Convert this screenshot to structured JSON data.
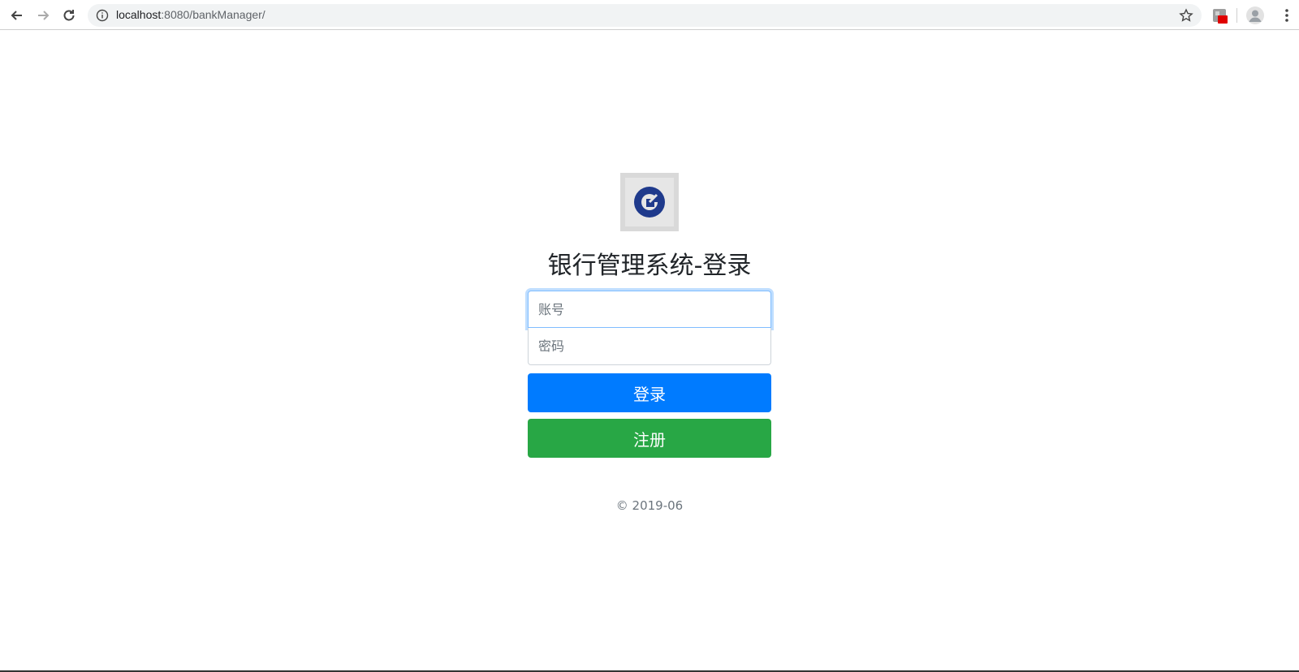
{
  "browser": {
    "url_host": "localhost",
    "url_rest": ":8080/bankManager/"
  },
  "login": {
    "title": "银行管理系统-登录",
    "account_placeholder": "账号",
    "password_placeholder": "密码",
    "login_label": "登录",
    "register_label": "注册",
    "copyright": "© 2019-06"
  },
  "colors": {
    "primary": "#007bff",
    "success": "#28a745",
    "logo": "#1f3a8c"
  }
}
